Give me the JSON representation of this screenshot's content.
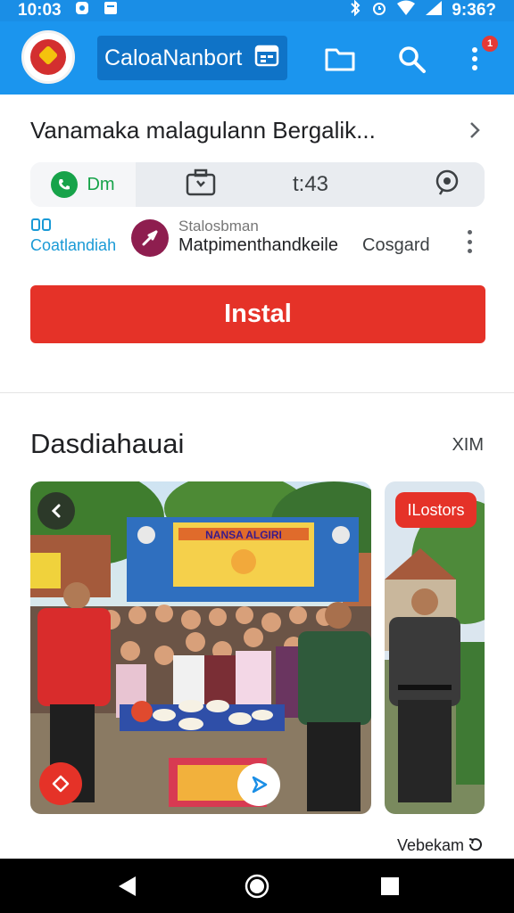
{
  "status_bar": {
    "time": "10:03",
    "battery": "9:36?",
    "icons": [
      "notification-icon",
      "sim-icon",
      "bluetooth-icon",
      "alarm-icon",
      "wifi-icon",
      "signal-icon"
    ]
  },
  "app_bar": {
    "search_text": "CaloaNanbort",
    "logo_name": "app-logo",
    "badge_count": "1",
    "accent": "#1b95ee"
  },
  "app": {
    "title": "Vanamaka malagulann Bergalik...",
    "call_label": "Dm",
    "time_label": "t:43",
    "developer_left": "Coatlandiah",
    "developer_sub": "Stalosbman",
    "developer_name": "Matpimenthandkeile",
    "developer_tag": "Cosgard",
    "install_label": "Instal",
    "install_color": "#e53228"
  },
  "section": {
    "title": "Dasdiahauai",
    "more": "XIM"
  },
  "gallery": {
    "banner_text": "NANSA ALGIRI",
    "side_badge": "ILostors"
  },
  "footer": {
    "link": "Vebekam"
  },
  "nav": {
    "back": "back-icon",
    "home": "home-icon",
    "recents": "recents-icon"
  }
}
